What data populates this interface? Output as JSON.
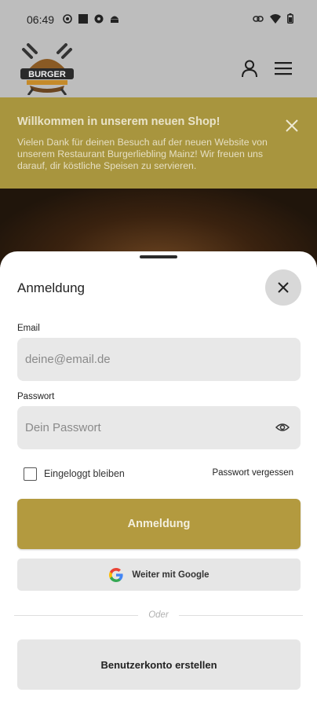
{
  "status_bar": {
    "time": "06:49"
  },
  "header": {
    "logo_text": "BURGER"
  },
  "banner": {
    "title": "Willkommen in unserem neuen Shop!",
    "text": "Vielen Dank für deinen Besuch auf der neuen Website von unserem Restaurant Burgerliebling Mainz! Wir freuen uns darauf, dir köstliche Speisen zu servieren."
  },
  "login": {
    "title": "Anmeldung",
    "email_label": "Email",
    "email_placeholder": "deine@email.de",
    "email_value": "",
    "password_label": "Passwort",
    "password_placeholder": "Dein Passwort",
    "password_value": "",
    "remember_label": "Eingeloggt bleiben",
    "remember_checked": false,
    "forgot_label": "Passwort vergessen",
    "submit_label": "Anmeldung",
    "google_label": "Weiter mit Google",
    "divider_text": "Oder",
    "create_label": "Benutzerkonto erstellen"
  },
  "colors": {
    "accent": "#b39a3f",
    "banner": "#a8953e",
    "field_bg": "#e8e8e8"
  },
  "icons": [
    "user-icon",
    "menu-icon",
    "close-icon",
    "eye-icon",
    "google-icon"
  ]
}
